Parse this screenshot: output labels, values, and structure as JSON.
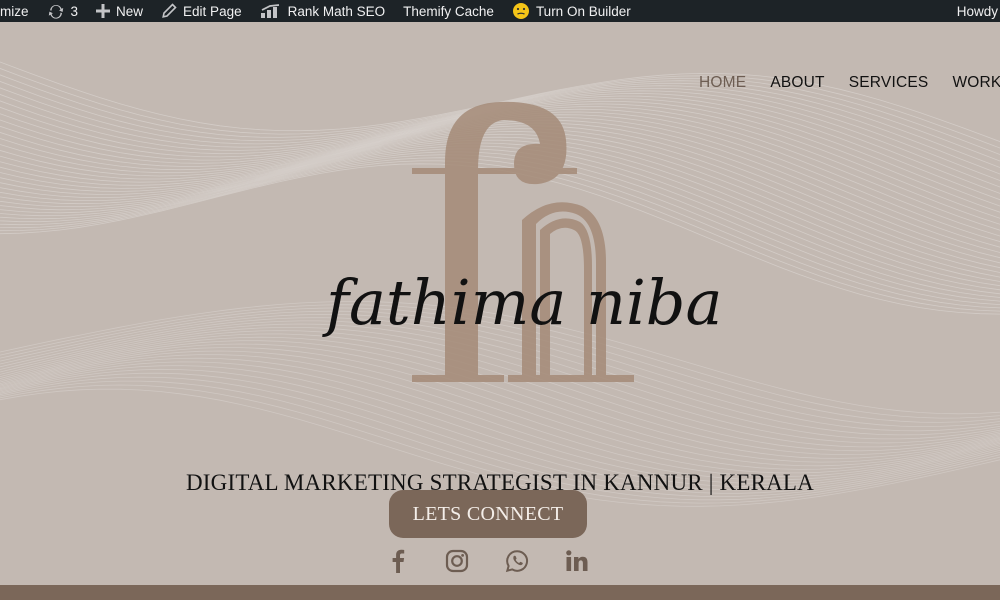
{
  "admin_bar": {
    "customize_label": "mize",
    "updates_count": "3",
    "new_label": "New",
    "edit_page_label": "Edit Page",
    "rank_math_label": "Rank Math SEO",
    "themify_cache_label": "Themify Cache",
    "builder_label": "Turn On Builder",
    "howdy_label": "Howdy"
  },
  "nav": {
    "items": [
      {
        "label": "HOME",
        "active": true
      },
      {
        "label": "ABOUT"
      },
      {
        "label": "SERVICES"
      },
      {
        "label": "WORKS"
      }
    ]
  },
  "hero": {
    "logo_text": "fathima niba",
    "tagline": "DIGITAL MARKETING STRATEGIST IN KANNUR | KERALA",
    "cta_label": "LETS CONNECT"
  },
  "social": [
    {
      "icon": "facebook-icon"
    },
    {
      "icon": "instagram-icon"
    },
    {
      "icon": "whatsapp-icon"
    },
    {
      "icon": "linkedin-icon"
    }
  ],
  "colors": {
    "background": "#c3b9b2",
    "accent": "#7b6759",
    "logo_monogram": "#a58b78",
    "admin_bar": "#1d2327"
  }
}
